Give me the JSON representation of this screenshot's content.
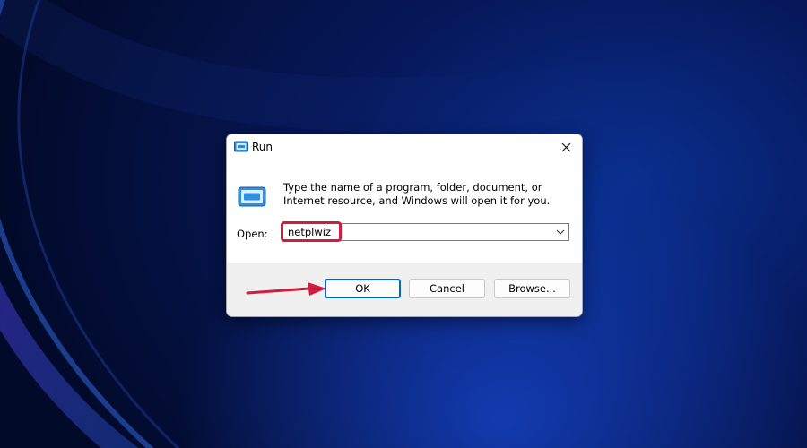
{
  "dialog": {
    "title": "Run",
    "description": "Type the name of a program, folder, document, or Internet resource, and Windows will open it for you.",
    "open_label": "Open:",
    "input_value": "netplwiz",
    "buttons": {
      "ok": "OK",
      "cancel": "Cancel",
      "browse": "Browse..."
    }
  },
  "icons": [
    "run-icon",
    "close-icon",
    "chevron-down-icon"
  ],
  "colors": {
    "highlight": "#d01c3f",
    "accent": "#0067c0"
  }
}
